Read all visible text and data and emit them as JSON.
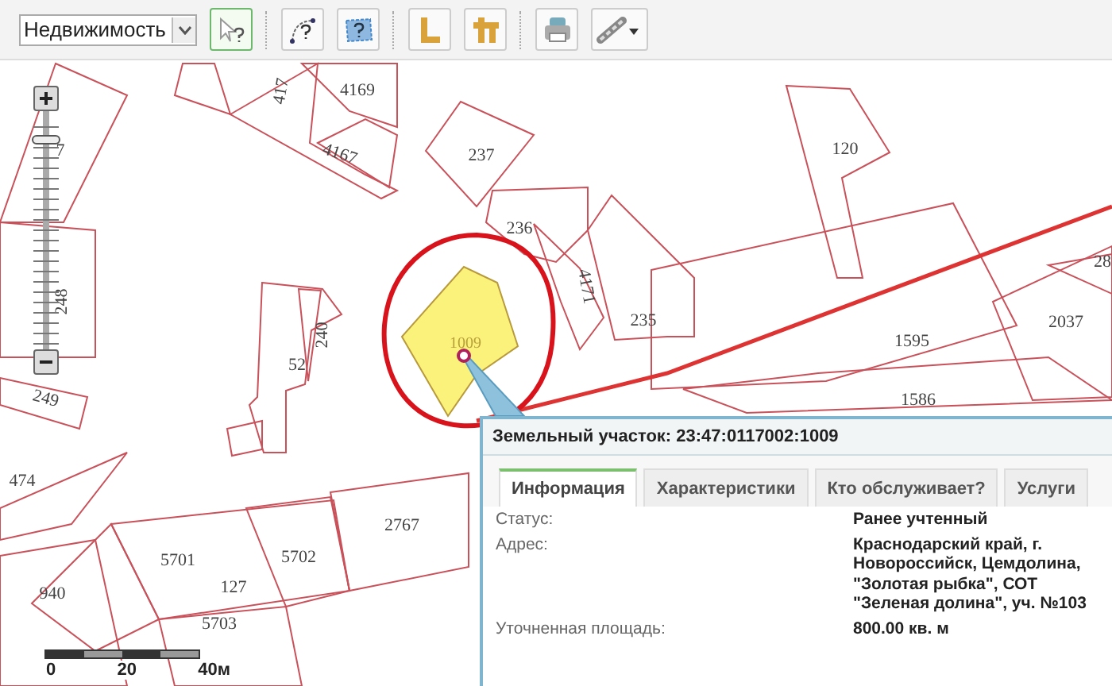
{
  "toolbar": {
    "layer_select": {
      "value": "Недвижимость"
    },
    "tools": [
      {
        "kind": "identify",
        "selected": true
      },
      {
        "kind": "curve",
        "selected": false
      },
      {
        "kind": "area",
        "selected": false
      },
      {
        "kind": "distance",
        "selected": false
      },
      {
        "kind": "square",
        "selected": false
      },
      {
        "kind": "print",
        "selected": false
      },
      {
        "kind": "link",
        "selected": false
      }
    ]
  },
  "map": {
    "zoom": {
      "level": 0.88
    },
    "parcels": [
      {
        "label": "4169"
      },
      {
        "label": "4167"
      },
      {
        "label": "237"
      },
      {
        "label": "236"
      },
      {
        "label": "417"
      },
      {
        "label": "7"
      },
      {
        "label": "248"
      },
      {
        "label": "52"
      },
      {
        "label": "240"
      },
      {
        "label": "249"
      },
      {
        "label": "474"
      },
      {
        "label": "2767"
      },
      {
        "label": "5701"
      },
      {
        "label": "5702"
      },
      {
        "label": "127"
      },
      {
        "label": "940"
      },
      {
        "label": "5703"
      },
      {
        "label": "120"
      },
      {
        "label": "4171"
      },
      {
        "label": "235"
      },
      {
        "label": "1595"
      },
      {
        "label": "1586"
      },
      {
        "label": "2037"
      },
      {
        "label": "28"
      }
    ],
    "selected_parcel": {
      "label": "1009"
    },
    "scale_bar": {
      "ticks": [
        "0",
        "20",
        "40м"
      ]
    }
  },
  "popup": {
    "title": "Земельный участок: 23:47:0117002:1009",
    "tabs": [
      {
        "label": "Информация",
        "selected": true
      },
      {
        "label": "Характеристики",
        "selected": false
      },
      {
        "label": "Кто обслуживает?",
        "selected": false
      },
      {
        "label": "Услуги",
        "selected": false
      }
    ],
    "fields": [
      {
        "label": "Статус:",
        "value": "Ранее учтенный"
      },
      {
        "label": "Адрес:",
        "value": "Краснодарский край, г. Новороссийск, Цемдолина, \"Золотая рыбка\", СОТ \"Зеленая долина\", уч. №103"
      },
      {
        "label": "Уточненная площадь:",
        "value": "800.00 кв. м"
      }
    ]
  }
}
